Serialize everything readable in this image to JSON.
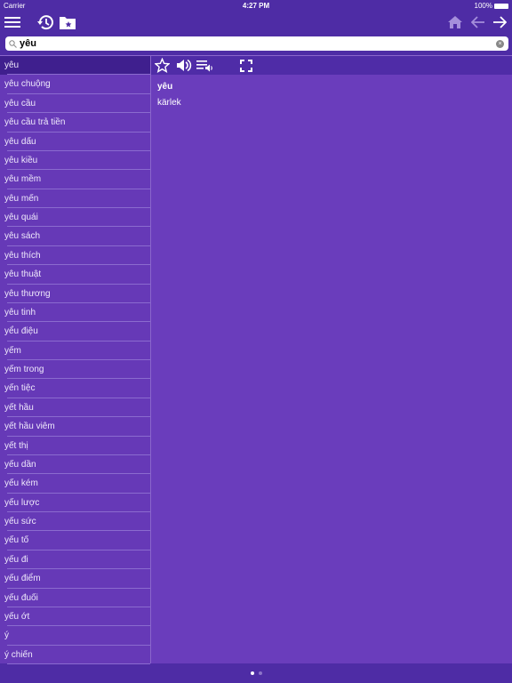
{
  "status": {
    "carrier": "Carrier",
    "time": "4:27 PM",
    "battery": "100%"
  },
  "search": {
    "value": "yêu"
  },
  "list": [
    "yêu",
    "yêu chuộng",
    "yêu cầu",
    "yêu cầu trả tiền",
    "yêu dấu",
    "yêu kiều",
    "yêu mềm",
    "yêu mến",
    "yêu quái",
    "yêu sách",
    "yêu thích",
    "yêu thuật",
    "yêu thương",
    "yêu tinh",
    "yểu điệu",
    "yếm",
    "yếm trong",
    "yến tiệc",
    "yết hầu",
    "yết hầu viêm",
    "yết thị",
    "yếu dần",
    "yếu kém",
    "yếu lược",
    "yếu sức",
    "yếu tố",
    "yếu đi",
    "yếu điểm",
    "yếu đuối",
    "yếu ớt",
    "ý",
    "ý chiến"
  ],
  "selected_index": 0,
  "detail": {
    "word": "yêu",
    "translation": "kärlek"
  },
  "colors": {
    "header": "#4e2ca5",
    "list": "#6639b7",
    "selected": "#3f1f8e",
    "detail": "#6a3dbc"
  },
  "pager": {
    "pages": 2,
    "current": 1
  }
}
